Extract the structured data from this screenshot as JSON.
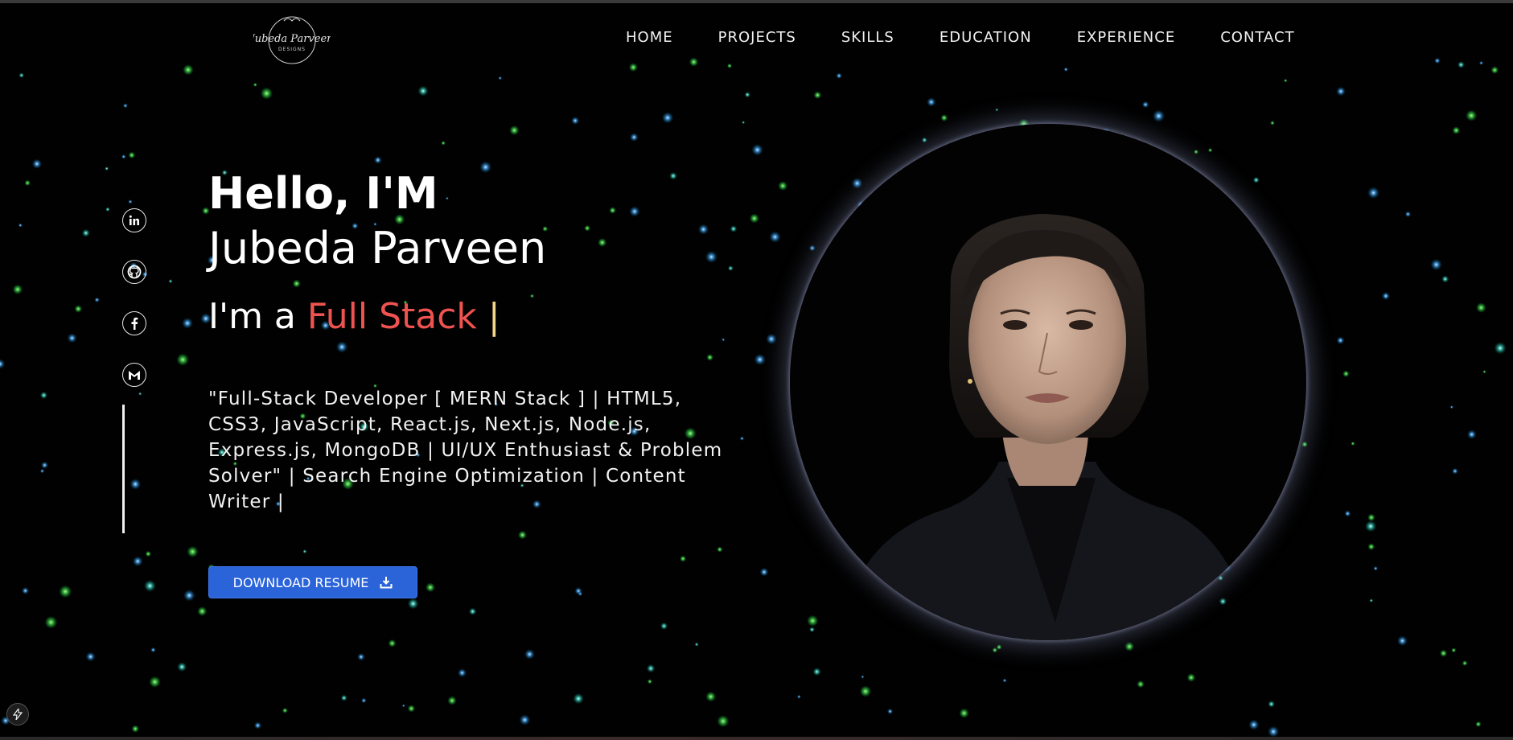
{
  "logo": {
    "title": "Jubeda Parveen",
    "subtitle": "DESIGNS"
  },
  "nav": {
    "items": [
      {
        "label": "HOME"
      },
      {
        "label": "PROJECTS"
      },
      {
        "label": "SKILLS"
      },
      {
        "label": "EDUCATION"
      },
      {
        "label": "EXPERIENCE"
      },
      {
        "label": "CONTACT"
      }
    ]
  },
  "social": [
    {
      "icon": "linkedin-icon"
    },
    {
      "icon": "github-icon"
    },
    {
      "icon": "facebook-icon"
    },
    {
      "icon": "gmail-icon"
    }
  ],
  "hero": {
    "greeting": "Hello, I'M",
    "name": "Jubeda Parveen",
    "role_prefix": "I'm a ",
    "role_accent": "Full Stack",
    "role_cursor": " |",
    "description": "\"Full-Stack Developer [ MERN Stack ] | HTML5, CSS3, JavaScript, React.js, Next.js, Node.js, Express.js, MongoDB | UI/UX Enthusiast & Problem Solver\" | Search Engine Optimization | Content Writer |",
    "download_label": "DOWNLOAD RESUME"
  },
  "colors": {
    "accent_red": "#ef5350",
    "cursor_yellow": "#f3d488",
    "button_blue": "#2b63d9"
  }
}
